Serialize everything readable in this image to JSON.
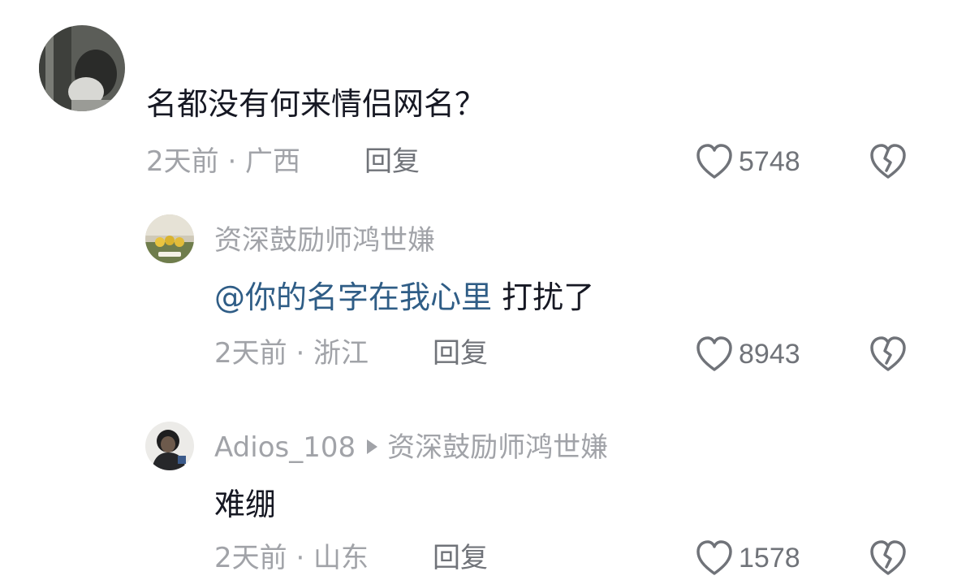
{
  "comments": [
    {
      "text": "名都没有何来情侣网名？",
      "meta": "2天前 · 广西",
      "reply_label": "回复",
      "likes": "5748"
    },
    {
      "username": "资深鼓励师鸿世嫌",
      "mention": "@你的名字在我心里",
      "text": " 打扰了",
      "meta": "2天前 · 浙江",
      "reply_label": "回复",
      "likes": "8943"
    },
    {
      "username": "Adios_108",
      "reply_to": "资深鼓励师鸿世嫌",
      "text": "难绷",
      "meta": "2天前 · 山东",
      "reply_label": "回复",
      "likes": "1578"
    }
  ],
  "colors": {
    "text": "#161823",
    "meta": "#a1a3a8",
    "action": "#707379",
    "mention": "#2f5d86"
  }
}
